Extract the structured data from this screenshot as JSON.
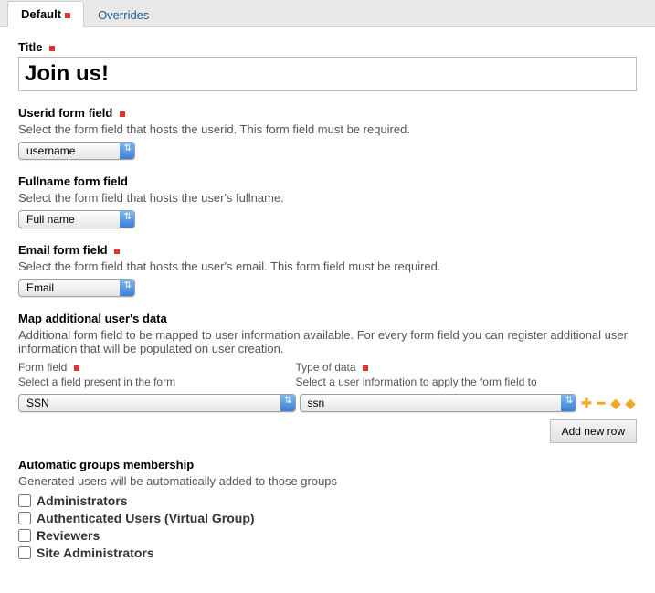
{
  "tabs": {
    "default": "Default",
    "overrides": "Overrides"
  },
  "title_field": {
    "label": "Title",
    "value": "Join us!"
  },
  "userid_field": {
    "label": "Userid form field",
    "help": "Select the form field that hosts the userid. This form field must be required.",
    "value": "username"
  },
  "fullname_field": {
    "label": "Fullname form field",
    "help": "Select the form field that hosts the user's fullname.",
    "value": "Full name"
  },
  "email_field": {
    "label": "Email form field",
    "help": "Select the form field that hosts the user's email. This form field must be required.",
    "value": "Email"
  },
  "map_section": {
    "label": "Map additional user's data",
    "help": "Additional form field to be mapped to user information available. For every form field you can register additional user information that will be populated on user creation.",
    "col1_label": "Form field",
    "col1_help": "Select a field present in the form",
    "col2_label": "Type of data",
    "col2_help": "Select a user information to apply the form field to",
    "row_form_field_value": "SSN",
    "row_type_value": "ssn",
    "add_row_label": "Add new row"
  },
  "groups_section": {
    "label": "Automatic groups membership",
    "help": "Generated users will be automatically added to those groups",
    "items": [
      {
        "label": "Administrators",
        "checked": false
      },
      {
        "label": "Authenticated Users (Virtual Group)",
        "checked": false
      },
      {
        "label": "Reviewers",
        "checked": false
      },
      {
        "label": "Site Administrators",
        "checked": false
      }
    ]
  }
}
